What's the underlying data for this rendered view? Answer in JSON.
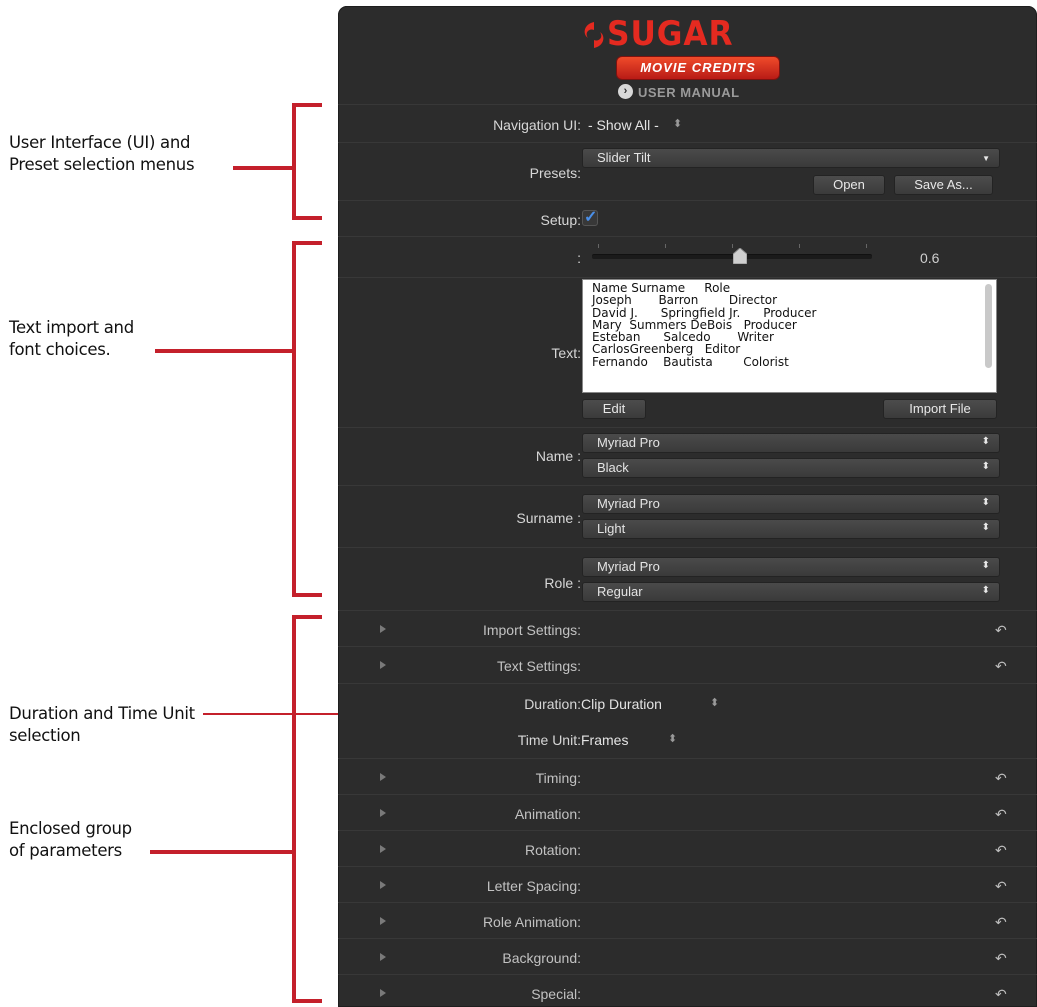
{
  "annotations": {
    "ui_presets": [
      "User Interface (UI) and",
      "Preset selection menus"
    ],
    "text_import": [
      "Text import and",
      "font choices."
    ],
    "duration": [
      "Duration and Time Unit",
      "selection"
    ],
    "enclosed": [
      "Enclosed group",
      "of parameters"
    ]
  },
  "colors": {
    "accent": "#c4202b",
    "panel": "#2c2c2c",
    "logo": "#e42a20"
  },
  "logo": {
    "word": "SUGAR",
    "badge": "MOVIE CREDITS",
    "manual": "USER MANUAL"
  },
  "navigation": {
    "label": "Navigation UI:",
    "value": "- Show All -"
  },
  "presets": {
    "label": "Presets:",
    "value": "Slider Tilt",
    "open": "Open",
    "save_as": "Save As..."
  },
  "setup": {
    "label": "Setup:",
    "checked": true
  },
  "slider": {
    "label": ":",
    "value": "0.6",
    "level": 0.6
  },
  "text": {
    "label": "Text:",
    "lines": [
      "Name Surname     Role",
      "Joseph       Barron        Director",
      "David J.      Springfield Jr.      Producer",
      "Mary  Summers DeBois   Producer",
      "Esteban      Salcedo       Writer",
      "CarlosGreenberg   Editor",
      "Fernando    Bautista        Colorist"
    ],
    "edit": "Edit",
    "import": "Import File"
  },
  "fonts": [
    {
      "label": "Name :",
      "family": "Myriad Pro",
      "style": "Black"
    },
    {
      "label": "Surname :",
      "family": "Myriad Pro",
      "style": "Light"
    },
    {
      "label": "Role :",
      "family": "Myriad Pro",
      "style": "Regular"
    }
  ],
  "groups_top": [
    "Import Settings:",
    "Text Settings:"
  ],
  "duration": {
    "label": "Duration:",
    "value": "Clip Duration"
  },
  "time_unit": {
    "label": "Time Unit:",
    "value": "Frames"
  },
  "groups_bottom": [
    "Timing:",
    "Animation:",
    "Rotation:",
    "Letter Spacing:",
    "Role Animation:",
    "Background:",
    "Special:"
  ]
}
